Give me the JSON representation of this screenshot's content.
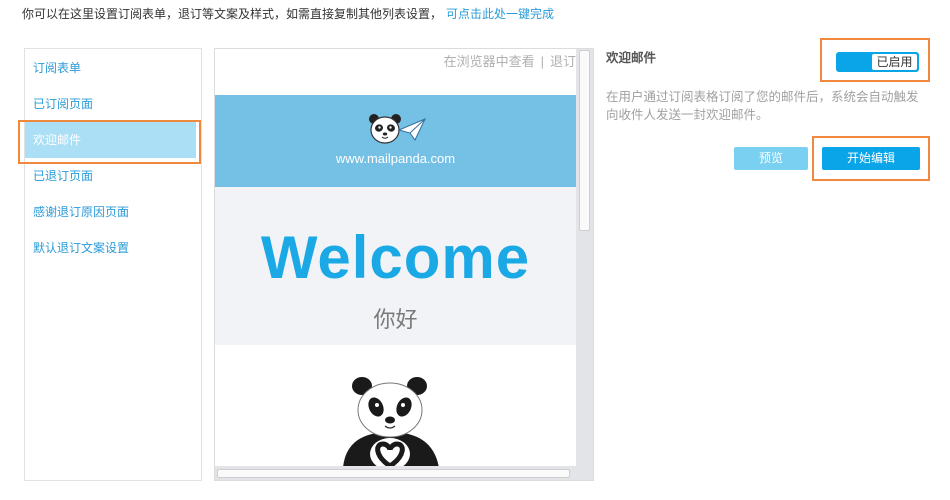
{
  "intro": {
    "text": "你可以在这里设置订阅表单，退订等文案及样式，如需直接复制其他列表设置，",
    "link": "可点击此处一键完成"
  },
  "sidebar": {
    "items": [
      {
        "label": "订阅表单",
        "selected": false
      },
      {
        "label": "已订阅页面",
        "selected": false
      },
      {
        "label": "欢迎邮件",
        "selected": true
      },
      {
        "label": "已退订页面",
        "selected": false
      },
      {
        "label": "感谢退订原因页面",
        "selected": false
      },
      {
        "label": "默认退订文案设置",
        "selected": false
      }
    ]
  },
  "preview": {
    "top_links": {
      "view_in_browser": "在浏览器中查看",
      "separator": "|",
      "unsubscribe": "退订"
    },
    "banner": {
      "logo_icon": "panda-logo-icon",
      "site": "www.mailpanda.com"
    },
    "headline": "Welcome",
    "greeting": "你好",
    "illustration_icon": "panda-illustration"
  },
  "panel": {
    "title": "欢迎邮件",
    "toggle": {
      "label": "已启用",
      "enabled": true
    },
    "description": "在用户通过订阅表格订阅了您的邮件后，系统会自动触发向收件人发送一封欢迎邮件。",
    "buttons": {
      "preview": "预览",
      "edit": "开始编辑"
    }
  },
  "colors": {
    "accent": "#0aa5e8",
    "link": "#2b9bd8",
    "banner": "#75c1e6",
    "headline": "#1ba9e6",
    "selected_item": "#abdff5",
    "preview_button": "#79d0f1",
    "annotation_highlight": "#f0883d"
  }
}
